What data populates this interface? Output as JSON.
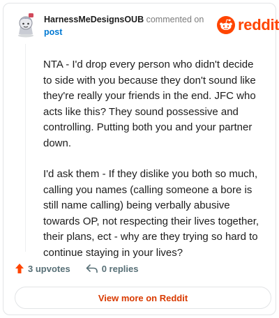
{
  "comment": {
    "author": "HarnessMeDesignsOUB",
    "commented_text": "commented on",
    "post_link": "post",
    "paragraphs": [
      "NTA - I'd drop every person who didn't decide to side with you because they don't sound like they're really your friends in the end. JFC who acts like this? They sound possessive and controlling. Putting both you and your partner down.",
      "I'd ask them - If they dislike you both so much, calling you names (calling someone a bore is still name calling) being verbally abusive towards OP, not respecting their lives together, their plans, ect - why are they trying so hard to continue staying in your lives?"
    ]
  },
  "brand": {
    "name": "reddit",
    "icon": "reddit-alien-icon",
    "color": "#ff4500"
  },
  "actions": {
    "upvotes": "3 upvotes",
    "upvote_icon": "upvote-arrow-icon",
    "replies": "0 replies",
    "reply_icon": "reply-arrow-icon"
  },
  "view_more": "View more on Reddit",
  "colors": {
    "link": "#0079d3",
    "upvote": "#ff4500",
    "view_more": "#d93a00"
  }
}
